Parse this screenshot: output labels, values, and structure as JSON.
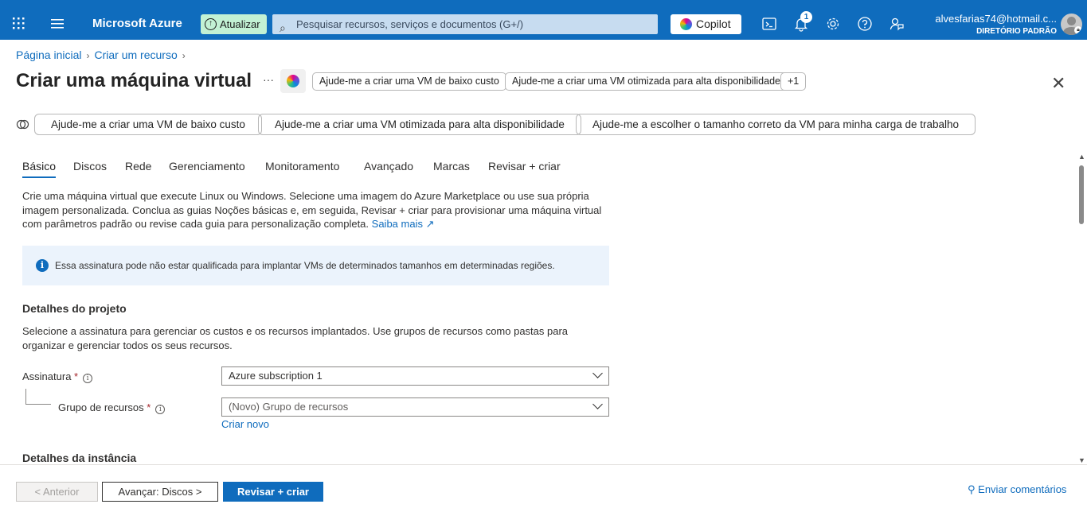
{
  "topbar": {
    "brand": "Microsoft Azure",
    "update_label": "Atualizar",
    "search_placeholder": "Pesquisar recursos, serviços e documentos (G+/)",
    "copilot_label": "Copilot",
    "notifications_count": "1",
    "account_email": "alvesfarias74@hotmail.c...",
    "account_directory": "DIRETÓRIO PADRÃO"
  },
  "breadcrumb": {
    "items": [
      "Página inicial",
      "Criar um recurso"
    ]
  },
  "page": {
    "title": "Criar uma máquina virtual",
    "more": "···",
    "header_prompts": [
      "Ajude-me a criar uma VM de baixo custo",
      "Ajude-me a criar uma VM otimizada para alta disponibilidade",
      "+1"
    ],
    "suggestions": [
      "Ajude-me a criar uma VM de baixo custo",
      "Ajude-me a criar uma VM otimizada para alta disponibilidade",
      "Ajude-me a escolher o tamanho correto da VM para minha carga de trabalho"
    ]
  },
  "tabs": [
    "Básico",
    "Discos",
    "Rede",
    "Gerenciamento",
    "Monitoramento",
    "Avançado",
    "Marcas",
    "Revisar + criar"
  ],
  "basics": {
    "description": "Crie uma máquina virtual que execute Linux ou Windows. Selecione uma imagem do Azure Marketplace ou use sua própria imagem personalizada. Conclua as guias Noções básicas e, em seguida, Revisar + criar para provisionar uma máquina virtual com parâmetros padrão ou revise cada guia para personalização completa.",
    "learn_more": "Saiba mais",
    "info_banner": "Essa assinatura pode não estar qualificada para implantar VMs de determinados tamanhos em determinadas regiões.",
    "project_details_heading": "Detalhes do projeto",
    "project_details_text": "Selecione a assinatura para gerenciar os custos e os recursos implantados. Use grupos de recursos como pastas para organizar e gerenciar todos os seus recursos.",
    "subscription_label": "Assinatura",
    "subscription_value": "Azure subscription 1",
    "resource_group_label": "Grupo de recursos",
    "resource_group_value": "(Novo) Grupo de recursos",
    "create_new": "Criar novo",
    "instance_details_heading": "Detalhes da instância"
  },
  "footer": {
    "previous": "< Anterior",
    "next": "Avançar: Discos >",
    "review_create": "Revisar + criar",
    "feedback": "Enviar comentários"
  },
  "colors": {
    "accent": "#0f6cbd",
    "update_bg": "#c2f1d4",
    "info_bg": "#ebf3fc",
    "required": "#a4262c"
  }
}
